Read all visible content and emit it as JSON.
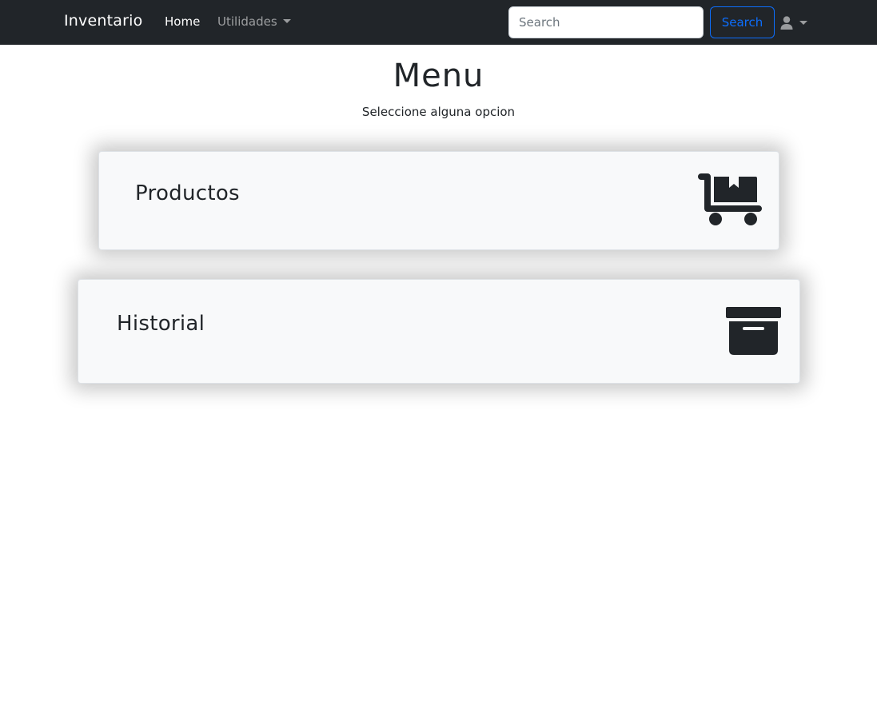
{
  "navbar": {
    "brand": "Inventario",
    "links": [
      {
        "label": "Home"
      },
      {
        "label": "Utilidades"
      }
    ],
    "search": {
      "placeholder": "Search",
      "value": "",
      "button_label": "Search"
    },
    "user_icon": "user-icon"
  },
  "header": {
    "title": "Menu",
    "subtitle": "Seleccione alguna opcion"
  },
  "cards": [
    {
      "title": "Productos",
      "icon": "dolly-flatbed-icon"
    },
    {
      "title": "Historial",
      "icon": "archive-box-icon"
    }
  ],
  "colors": {
    "navbar_bg": "#212529",
    "accent": "#0d6efd",
    "card_bg": "#f8f9fa"
  }
}
